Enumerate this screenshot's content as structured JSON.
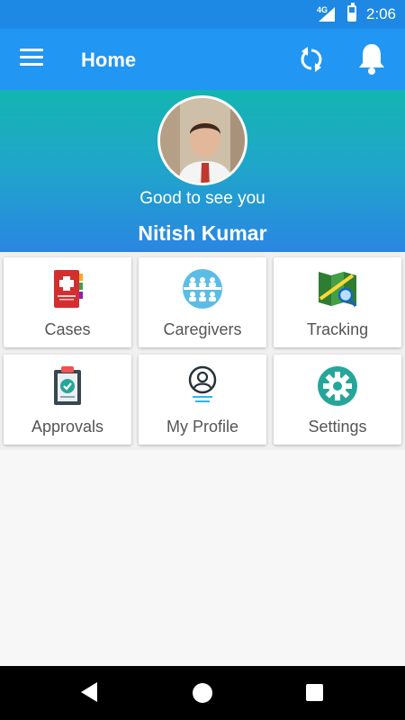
{
  "status_bar": {
    "network": "4G",
    "time": "2:06"
  },
  "app_bar": {
    "title": "Home",
    "menu_icon": "hamburger-menu-icon",
    "sync_icon": "sync-icon",
    "bell_icon": "notification-bell-icon"
  },
  "hero": {
    "greeting": "Good to see you",
    "name": "Nitish Kumar"
  },
  "tiles": [
    {
      "label": "Cases",
      "icon": "medical-binder-icon"
    },
    {
      "label": "Caregivers",
      "icon": "caregivers-group-icon"
    },
    {
      "label": "Tracking",
      "icon": "map-tracking-icon"
    },
    {
      "label": "Approvals",
      "icon": "clipboard-check-icon"
    },
    {
      "label": "My Profile",
      "icon": "profile-user-icon"
    },
    {
      "label": "Settings",
      "icon": "settings-gear-icon"
    }
  ],
  "colors": {
    "status_bar": "#1e88e5",
    "app_bar": "#2196f3",
    "hero_top": "#13b5b1",
    "hero_bottom": "#2a86e2"
  }
}
